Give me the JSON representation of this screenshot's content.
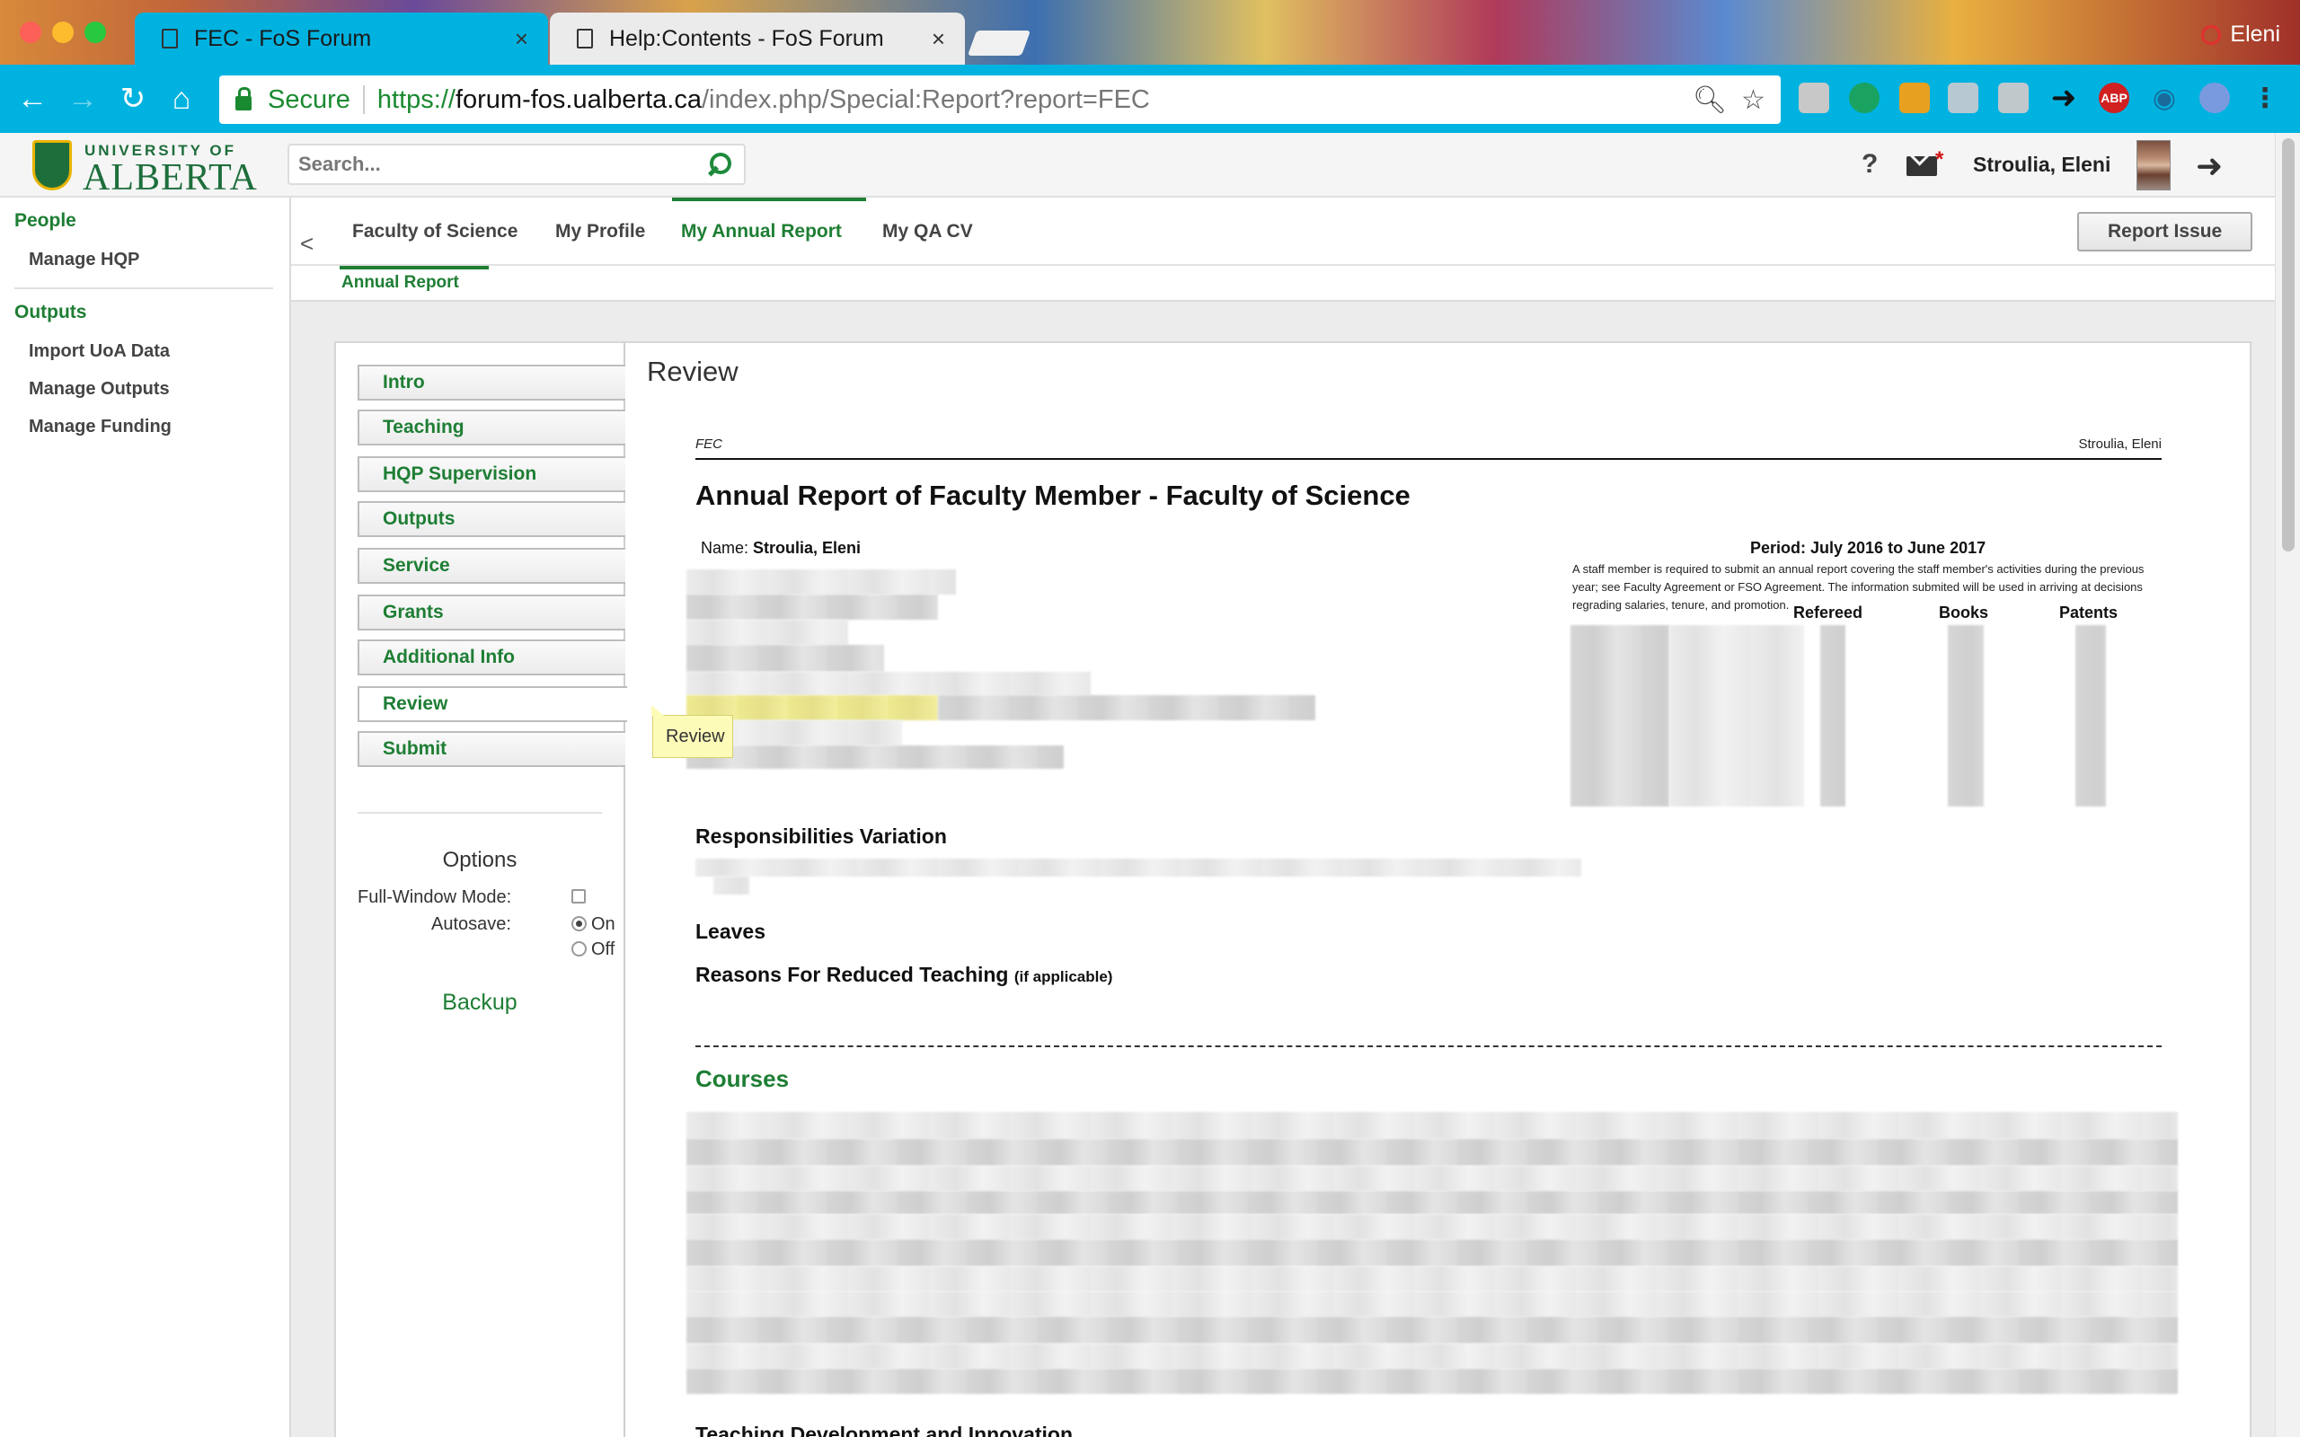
{
  "browser": {
    "tabs": [
      {
        "title": "FEC - FoS Forum",
        "active": true
      },
      {
        "title": "Help:Contents - FoS Forum",
        "active": false
      }
    ],
    "profile_name": "Eleni",
    "secure_label": "Secure",
    "url": {
      "scheme": "https://",
      "host": "forum-fos.ualberta.ca",
      "path": "/index.php/Special:Report?report=FEC"
    },
    "extensions": [
      "note-icon",
      "hangouts-icon",
      "rss-icon",
      "cast-icon",
      "drive-icon",
      "share-icon",
      "adblock-plus-icon",
      "eye-icon",
      "vpn-icon"
    ],
    "adblock_label": "ABP",
    "colors": {
      "toolbar": "#00b2e0",
      "secure": "#1a8a30"
    }
  },
  "header": {
    "logo_top": "UNIVERSITY OF",
    "logo_bottom": "ALBERTA",
    "search_placeholder": "Search...",
    "help": "?",
    "mail_badge": "*",
    "user_name": "Stroulia, Eleni"
  },
  "sidebar": {
    "sections": [
      {
        "title": "People",
        "items": [
          "Manage HQP"
        ]
      },
      {
        "title": "Outputs",
        "items": [
          "Import UoA Data",
          "Manage Outputs",
          "Manage Funding"
        ]
      }
    ]
  },
  "nav": {
    "collapse": "<",
    "tabs": [
      "Faculty of Science",
      "My Profile",
      "My Annual Report",
      "My QA CV"
    ],
    "active_tab": "My Annual Report",
    "subtab": "Annual Report",
    "report_issue": "Report Issue"
  },
  "report": {
    "steps": [
      "Intro",
      "Teaching",
      "HQP Supervision",
      "Outputs",
      "Service",
      "Grants",
      "Additional Info",
      "Review",
      "Submit"
    ],
    "current_step": "Review",
    "tooltip": "Review",
    "options": {
      "title": "Options",
      "full_window_label": "Full-Window Mode:",
      "full_window_checked": false,
      "autosave_label": "Autosave:",
      "autosave_on": "On",
      "autosave_off": "Off",
      "autosave_value": "On"
    },
    "backup": "Backup"
  },
  "review": {
    "title": "Review",
    "doc": {
      "header_left": "FEC",
      "header_right": "Stroulia, Eleni",
      "heading": "Annual Report of Faculty Member - Faculty of Science",
      "name_label": "Name:",
      "name_value": "Stroulia, Eleni",
      "period": "Period: July 2016 to June 2017",
      "note": "A staff member is required to submit an annual report covering the staff member's activities during the previous year; see Faculty Agreement or FSO Agreement. The information submited will be used in arriving at decisions regrading salaries, tenure, and promotion.",
      "columns": [
        "Refereed",
        "Books",
        "Patents"
      ],
      "sections": {
        "responsibilities": "Responsibilities Variation",
        "leaves": "Leaves",
        "reduced_teaching": "Reasons For Reduced Teaching",
        "reduced_teaching_note": "(if applicable)",
        "courses": "Courses",
        "teaching_dev": "Teaching Development and Innovation"
      }
    }
  },
  "colors": {
    "brand_green": "#1e7e34",
    "tooltip": "#fdfbb8"
  }
}
